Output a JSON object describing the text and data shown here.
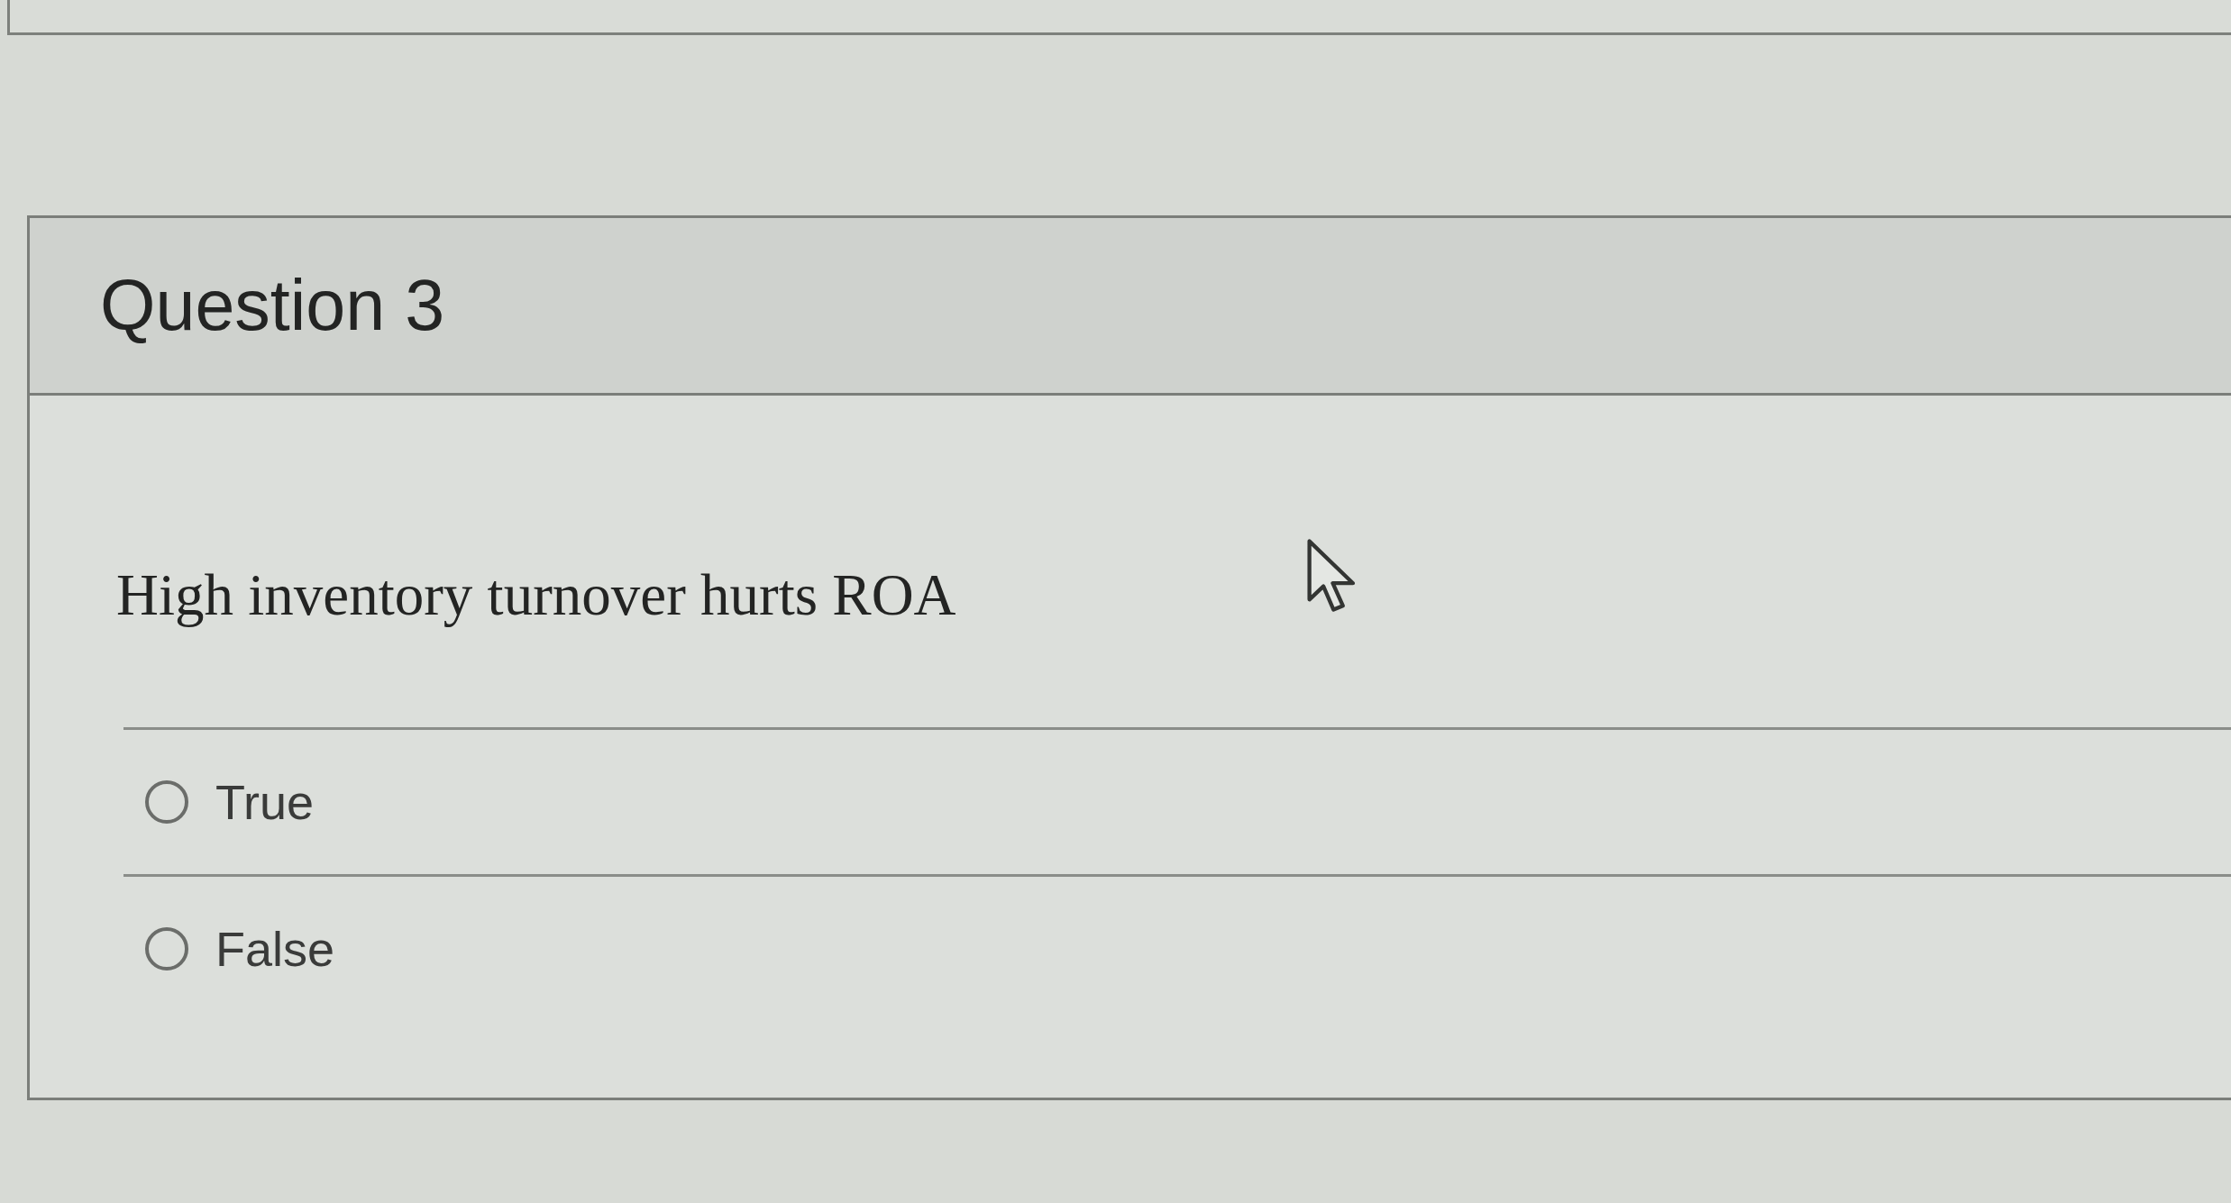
{
  "quiz": {
    "question": {
      "title": "Question 3",
      "text": "High inventory turnover hurts ROA",
      "options": [
        {
          "label": "True",
          "selected": false
        },
        {
          "label": "False",
          "selected": false
        }
      ]
    }
  }
}
